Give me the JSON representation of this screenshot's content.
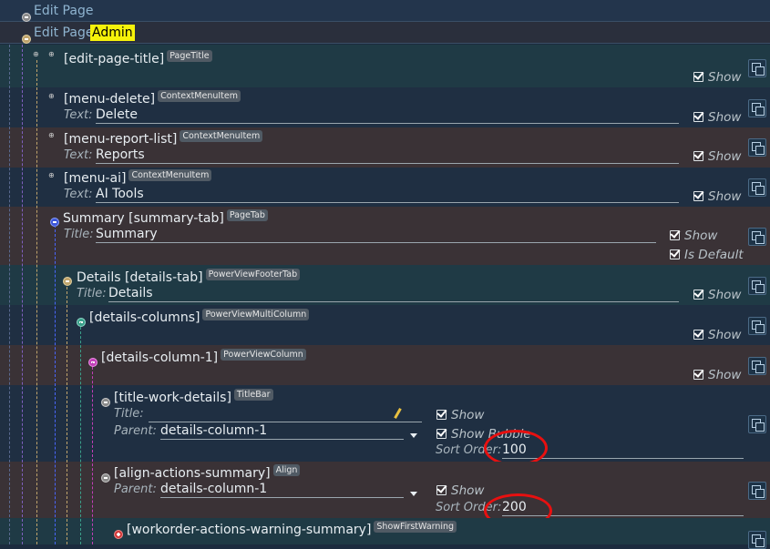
{
  "headers": {
    "edit_page": "Edit Page",
    "edit_page_admin": "Edit Page",
    "admin_badge": "Admin"
  },
  "field_labels": {
    "text": "Text:",
    "title": "Title:",
    "parent": "Parent:",
    "sort_order": "Sort Order:"
  },
  "checks": {
    "show": "Show",
    "is_default": "Is Default",
    "show_bubble": "Show Bubble"
  },
  "nodes": {
    "edit_page_title": {
      "label": "[edit-page-title]",
      "type": "PageTitle"
    },
    "menu_delete": {
      "label": "[menu-delete]",
      "type": "ContextMenuItem",
      "text": "Delete"
    },
    "menu_report_list": {
      "label": "[menu-report-list]",
      "type": "ContextMenuItem",
      "text": "Reports"
    },
    "menu_ai": {
      "label": "[menu-ai]",
      "type": "ContextMenuItem",
      "text": "AI Tools"
    },
    "summary_tab": {
      "label": "Summary [summary-tab]",
      "type": "PageTab",
      "title": "Summary"
    },
    "details_tab": {
      "label": "Details [details-tab]",
      "type": "PowerViewFooterTab",
      "title": "Details"
    },
    "details_columns": {
      "label": "[details-columns]",
      "type": "PowerViewMultiColumn"
    },
    "details_column_1": {
      "label": "[details-column-1]",
      "type": "PowerViewColumn"
    },
    "title_work_details": {
      "label": "[title-work-details]",
      "type": "TitleBar",
      "title": "",
      "parent": "details-column-1",
      "sort_order": "100"
    },
    "align_actions_summary": {
      "label": "[align-actions-summary]",
      "type": "Align",
      "parent": "details-column-1",
      "sort_order": "200"
    },
    "workorder_actions_warning": {
      "label": "[workorder-actions-warning-summary]",
      "type": "ShowFirstWarning"
    }
  },
  "colors": {
    "highlight": "#f6f20a",
    "annotation_circle": "#e81010"
  }
}
